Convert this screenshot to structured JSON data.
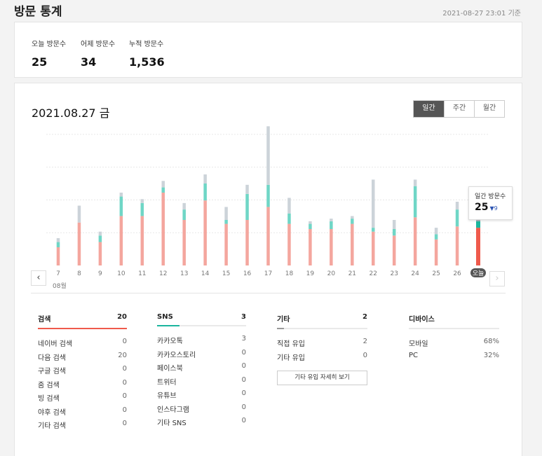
{
  "header": {
    "title": "방문 통계",
    "timestamp": "2021-08-27 23:01 기준"
  },
  "summary": [
    {
      "label": "오늘 방문수",
      "value": "25"
    },
    {
      "label": "어제 방문수",
      "value": "34"
    },
    {
      "label": "누적 방문수",
      "value": "1,536"
    }
  ],
  "main": {
    "date_title": "2021.08.27 금",
    "tabs": [
      {
        "label": "일간",
        "active": true
      },
      {
        "label": "주간",
        "active": false
      },
      {
        "label": "월간",
        "active": false
      }
    ],
    "month_label": "08월",
    "tooltip": {
      "label": "일간 방문수",
      "value": "25",
      "delta": "▼9"
    }
  },
  "chart_data": {
    "type": "bar",
    "categories": [
      "7",
      "8",
      "9",
      "10",
      "11",
      "12",
      "13",
      "14",
      "15",
      "16",
      "17",
      "18",
      "19",
      "20",
      "21",
      "22",
      "23",
      "24",
      "25",
      "26",
      "오늘"
    ],
    "series": [
      {
        "values": [
          14,
          33,
          18,
          38,
          38,
          56,
          35,
          50,
          32,
          35,
          45,
          32,
          28,
          28,
          32,
          26,
          23,
          37,
          20,
          30,
          29
        ]
      },
      {
        "values": [
          4,
          0,
          5,
          15,
          10,
          4,
          8,
          13,
          3,
          20,
          17,
          8,
          4,
          6,
          4,
          3,
          5,
          24,
          4,
          13,
          5
        ]
      },
      {
        "values": [
          3,
          13,
          3,
          3,
          3,
          5,
          5,
          7,
          10,
          7,
          45,
          12,
          2,
          2,
          2,
          37,
          7,
          5,
          5,
          6,
          2
        ]
      }
    ],
    "colors": [
      "#f4a69e",
      "#6fd6c6",
      "#ccd3d9"
    ],
    "today_colors": [
      "#ef5a4c",
      "#1bb59e",
      "#a9b3bb"
    ],
    "ylim": [
      0,
      105
    ]
  },
  "breakdown": [
    {
      "title": "검색",
      "total": "20",
      "accent": "#ef5a4c",
      "fill": 1.0,
      "rows": [
        [
          "네이버 검색",
          "0"
        ],
        [
          "다음 검색",
          "20"
        ],
        [
          "구글 검색",
          "0"
        ],
        [
          "줌 검색",
          "0"
        ],
        [
          "빙 검색",
          "0"
        ],
        [
          "야후 검색",
          "0"
        ],
        [
          "기타 검색",
          "0"
        ]
      ]
    },
    {
      "title": "SNS",
      "total": "3",
      "accent": "#1bb59e",
      "fill": 0.25,
      "rows": [
        [
          "카카오톡",
          "3"
        ],
        [
          "카카오스토리",
          "0"
        ],
        [
          "페이스북",
          "0"
        ],
        [
          "트위터",
          "0"
        ],
        [
          "유튜브",
          "0"
        ],
        [
          "인스타그램",
          "0"
        ],
        [
          "기타 SNS",
          "0"
        ]
      ]
    },
    {
      "title": "기타",
      "total": "2",
      "accent": "#999999",
      "fill": 0.08,
      "rows": [
        [
          "직접 유입",
          "2"
        ],
        [
          "기타 유입",
          "0"
        ]
      ],
      "button": "기타 유입 자세히 보기"
    },
    {
      "title": "디바이스",
      "total": "",
      "accent": "#e9e9e9",
      "fill": 0,
      "rows": [
        [
          "모바일",
          "68%"
        ],
        [
          "PC",
          "32%"
        ]
      ]
    }
  ]
}
